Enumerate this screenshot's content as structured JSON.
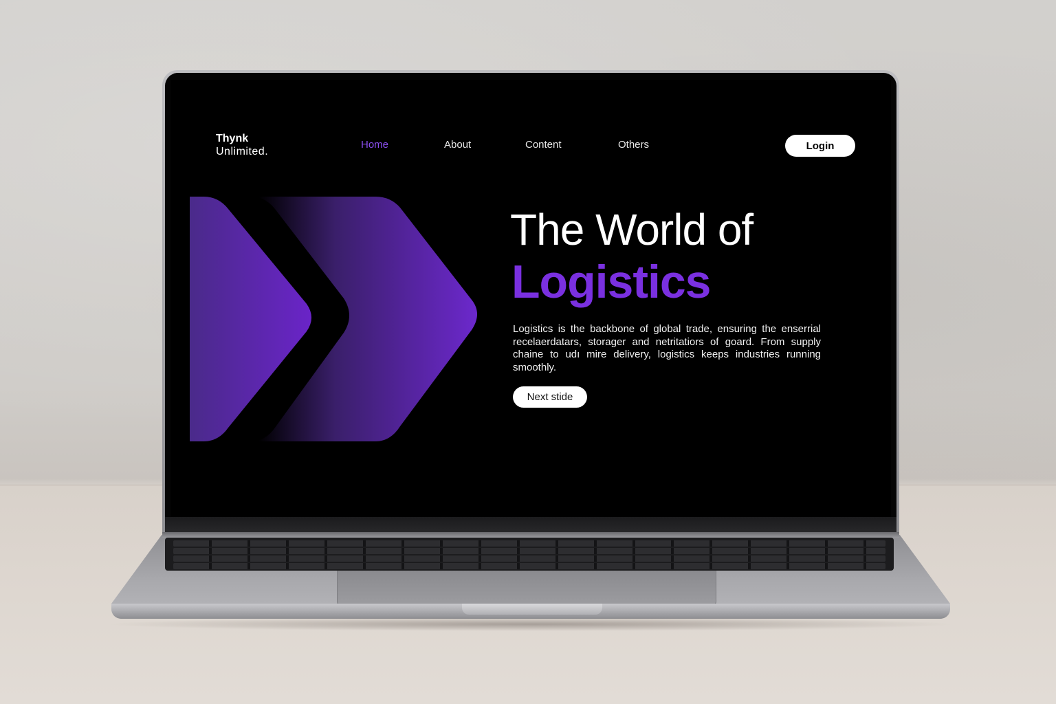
{
  "brand": {
    "line1": "Thynk",
    "line2": "Unlimited."
  },
  "nav": {
    "items": [
      {
        "label": "Home",
        "active": true
      },
      {
        "label": "About",
        "active": false
      },
      {
        "label": "Content",
        "active": false
      },
      {
        "label": "Others",
        "active": false
      }
    ],
    "login_label": "Login"
  },
  "hero": {
    "title": "The World of",
    "accent": "Logistics",
    "body": "Logistics is the backbone of global trade, ensuring the enserrial recelaerdatars, storager and netritatiors of goard. From supply chaine to udı mire delivery, logistics keeps industries running smoothly.",
    "button_label": "Next stide"
  },
  "colors": {
    "accent": "#7a30e0",
    "active_nav": "#8b4ff0",
    "screen_bg": "#000000",
    "button_bg": "#ffffff"
  }
}
